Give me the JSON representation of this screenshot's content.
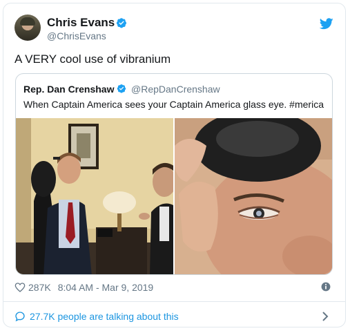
{
  "tweet": {
    "author_name": "Chris Evans",
    "author_handle": "@ChrisEvans",
    "text": "A VERY cool use of vibranium"
  },
  "quoted_tweet": {
    "author_name": "Rep. Dan Crenshaw",
    "author_handle": "@RepDanCrenshaw",
    "text": "When Captain America sees your Captain America glass eye. #merica"
  },
  "meta": {
    "likes": "287K",
    "timestamp": "8:04 AM - Mar 9, 2019"
  },
  "footer": {
    "talking_text": "27.7K people are talking about this"
  },
  "colors": {
    "twitter_blue": "#1da1f2",
    "link_blue": "#1b95e0",
    "muted_gray": "#657786"
  },
  "icons": [
    "verified-badge-icon",
    "twitter-bird-icon",
    "heart-icon",
    "info-icon",
    "speech-bubble-icon",
    "chevron-right-icon"
  ]
}
